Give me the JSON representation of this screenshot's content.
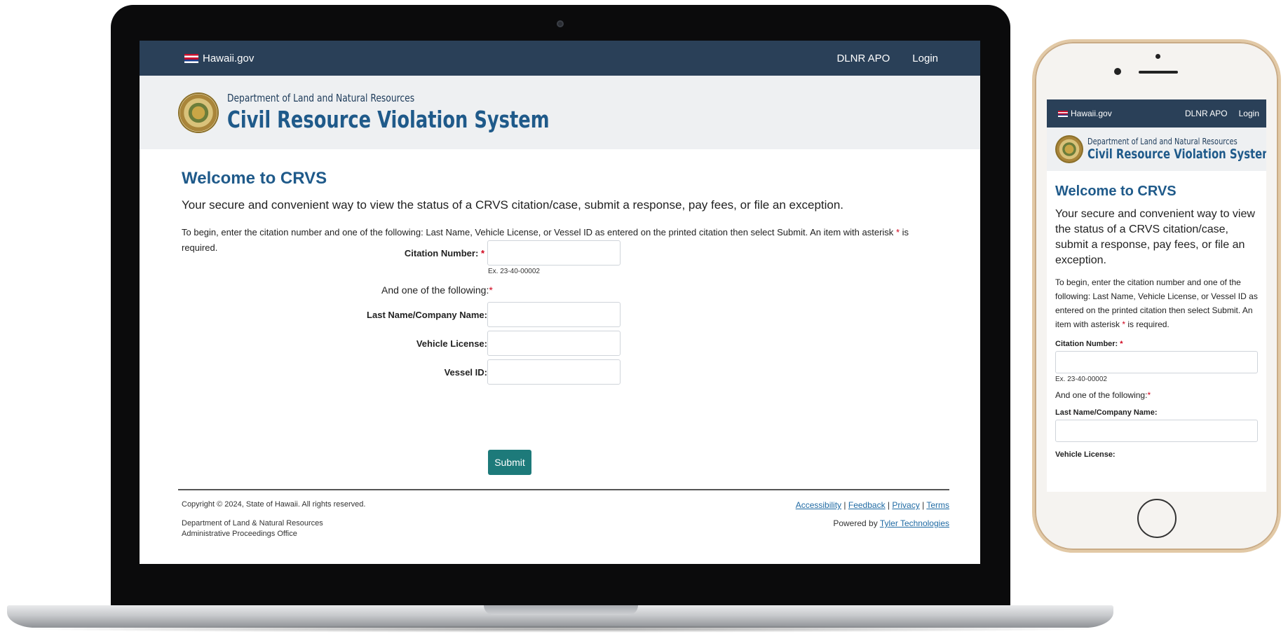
{
  "site": {
    "gov_link": "Hawaii.gov",
    "nav": {
      "dlnr_apo": "DLNR APO",
      "login": "Login"
    },
    "dept_name": "Department of Land and Natural Resources",
    "system_name": "Civil Resource Violation System",
    "accent_color": "#2a4058",
    "button_color": "#1d7a7a"
  },
  "main": {
    "welcome": "Welcome to CRVS",
    "lead": "Your secure and convenient way to view the status of a CRVS citation/case, submit a response, pay fees, or file an exception.",
    "instructions": "To begin, enter the citation number and one of the following: Last Name, Vehicle License, or Vessel ID as entered on the printed citation then select Submit. An item with asterisk",
    "asterisk": "*",
    "instructions_end": "is required."
  },
  "form": {
    "citation_label": "Citation Number:",
    "citation_hint": "Ex. 23-40-00002",
    "one_of_label": "And one of the following:",
    "last_name_label": "Last Name/Company Name:",
    "vehicle_label": "Vehicle License:",
    "vessel_label": "Vessel ID:",
    "submit_label": "Submit"
  },
  "footer": {
    "copyright": "Copyright © 2024, State of Hawaii. All rights reserved.",
    "dept_line1": "Department of Land & Natural Resources",
    "dept_line2": "Administrative Proceedings Office",
    "links": [
      "Accessibility",
      "Feedback",
      "Privacy",
      "Terms"
    ],
    "separator": "|",
    "powered_by": "Powered by",
    "powered_link": "Tyler Technologies"
  }
}
